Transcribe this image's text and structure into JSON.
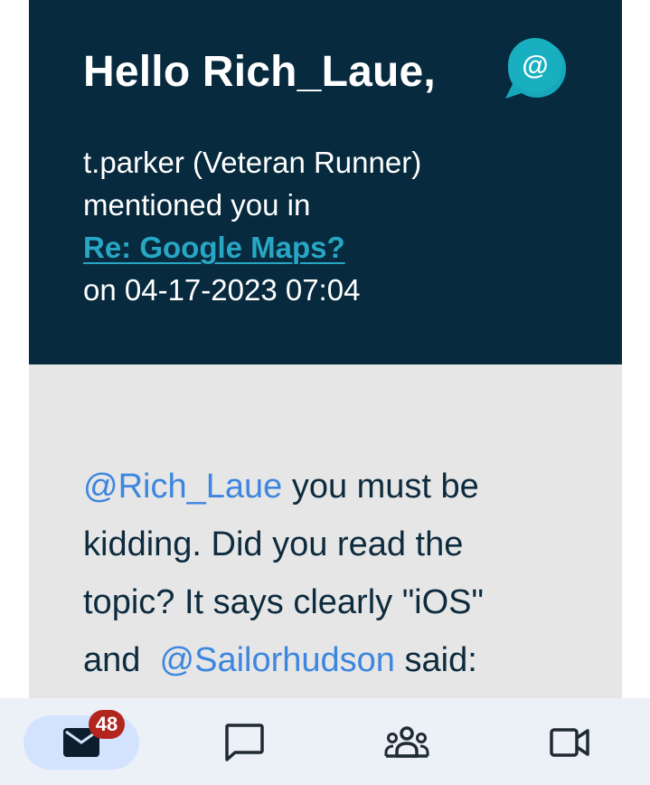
{
  "header": {
    "greeting": "Hello Rich_Laue,",
    "mention_line": "t.parker (Veteran Runner)",
    "mentioned_text": "mentioned you in",
    "topic_link": "Re: Google Maps?",
    "date_line": "on 04-17-2023 07:04",
    "badge_icon": "at-sign-chat-bubble-icon",
    "badge_symbol": "@"
  },
  "message": {
    "line1_mention": "@Rich_Laue",
    "line1_rest": " you must be",
    "line2": "kidding. Did you read the",
    "line3": "topic? It says clearly \"iOS\"",
    "line4_start": "and  ",
    "line4_mention": "@Sailorhudson",
    "line4_end": " said:"
  },
  "bottom_nav": {
    "items": [
      {
        "name": "mail",
        "icon": "mail-icon",
        "badge": "48",
        "active": true
      },
      {
        "name": "chat",
        "icon": "chat-icon"
      },
      {
        "name": "spaces",
        "icon": "groups-icon"
      },
      {
        "name": "meet",
        "icon": "video-icon"
      }
    ]
  },
  "colors": {
    "header_bg": "#072a3e",
    "link": "#27a7c4",
    "mention": "#3d86e0",
    "body_bg": "#e6e6e6",
    "badge": "#b3261e",
    "nav_bg": "#ecf1f7",
    "active_pill": "#d3e3fd"
  }
}
